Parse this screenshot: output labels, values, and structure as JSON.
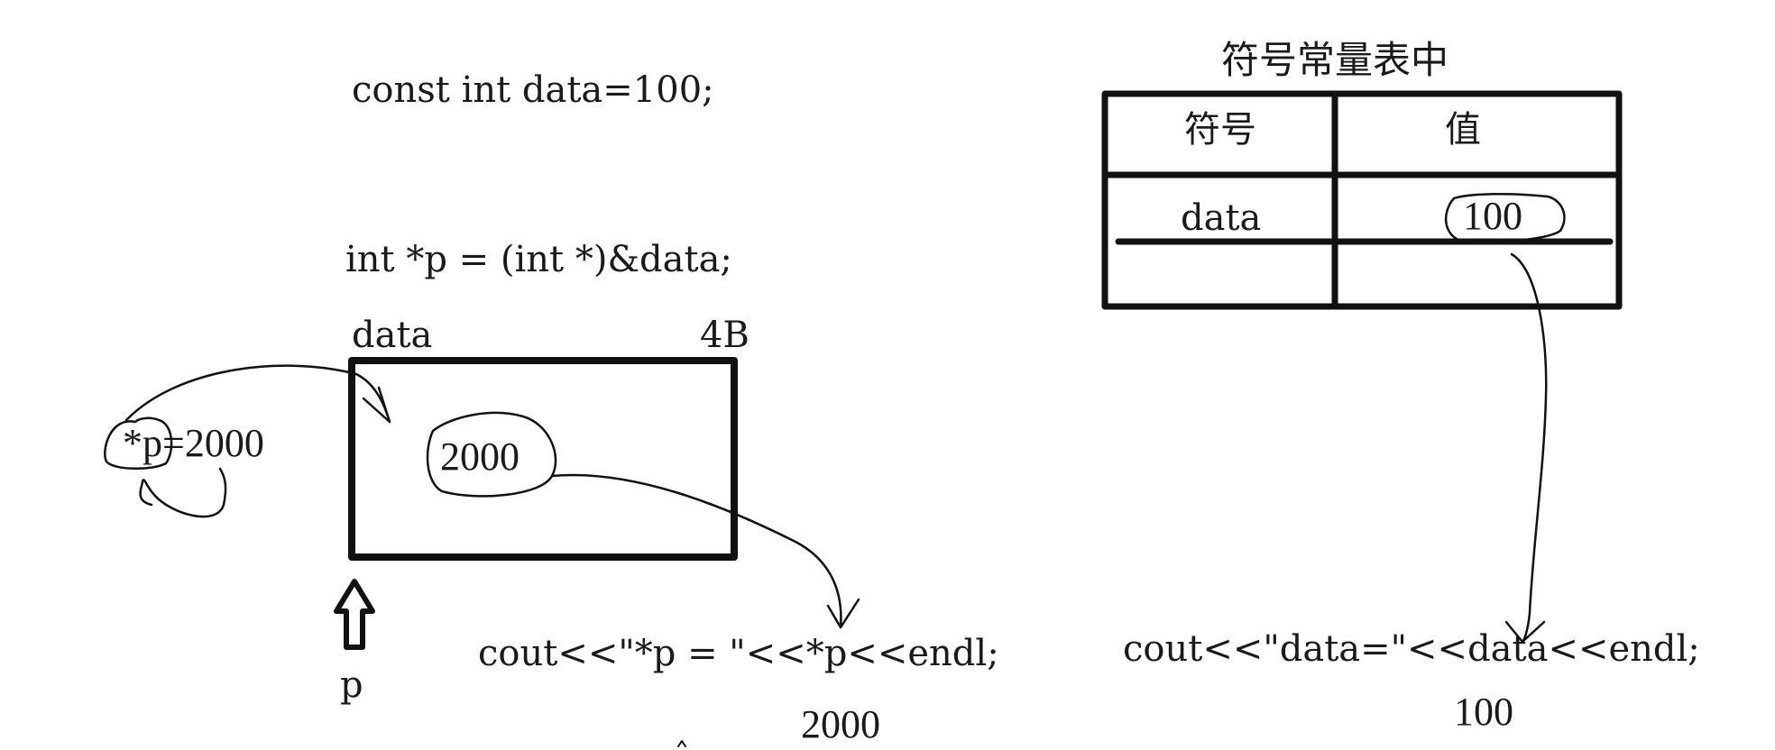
{
  "code": {
    "decl": "const int data=100;",
    "ptr": "int *p = (int *)&data;",
    "cout_p": "cout<<\"*p = \"<<*p<<endl;",
    "cout_data": "cout<<\"data=\"<<data<<endl;"
  },
  "memory": {
    "var_label": "data",
    "size_label": "4B",
    "cell_value": "2000",
    "pointer_label": "p"
  },
  "annotations": {
    "assign": "*p=2000",
    "out_p": "2000",
    "out_data": "100"
  },
  "symbol_table": {
    "title": "符号常量表中",
    "headers": [
      "符号",
      "值"
    ],
    "rows": [
      {
        "symbol": "data",
        "value": "100"
      }
    ]
  }
}
